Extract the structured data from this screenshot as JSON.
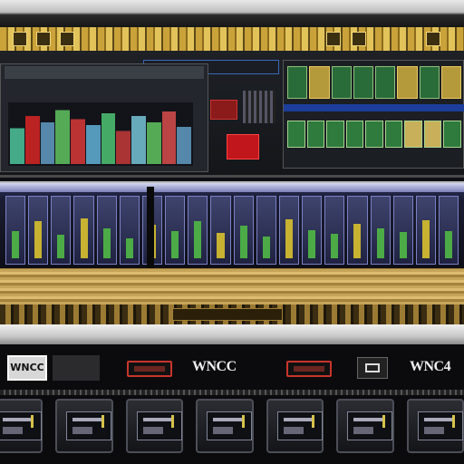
{
  "window": {
    "title": ""
  },
  "bottom_unit": {
    "left_logo": "WNCC",
    "brand_center": "WNCC",
    "brand_right": "WNC4",
    "button_left_label": "",
    "button_right_label": ""
  },
  "colors": {
    "gold": "#caa23a",
    "mixer_blue": "#2a2f5a",
    "accent_red": "#c0161c",
    "meter_green": "#4cab46"
  },
  "icons": {
    "top_record": "square-icon",
    "bottom_right": "monitor-icon"
  }
}
